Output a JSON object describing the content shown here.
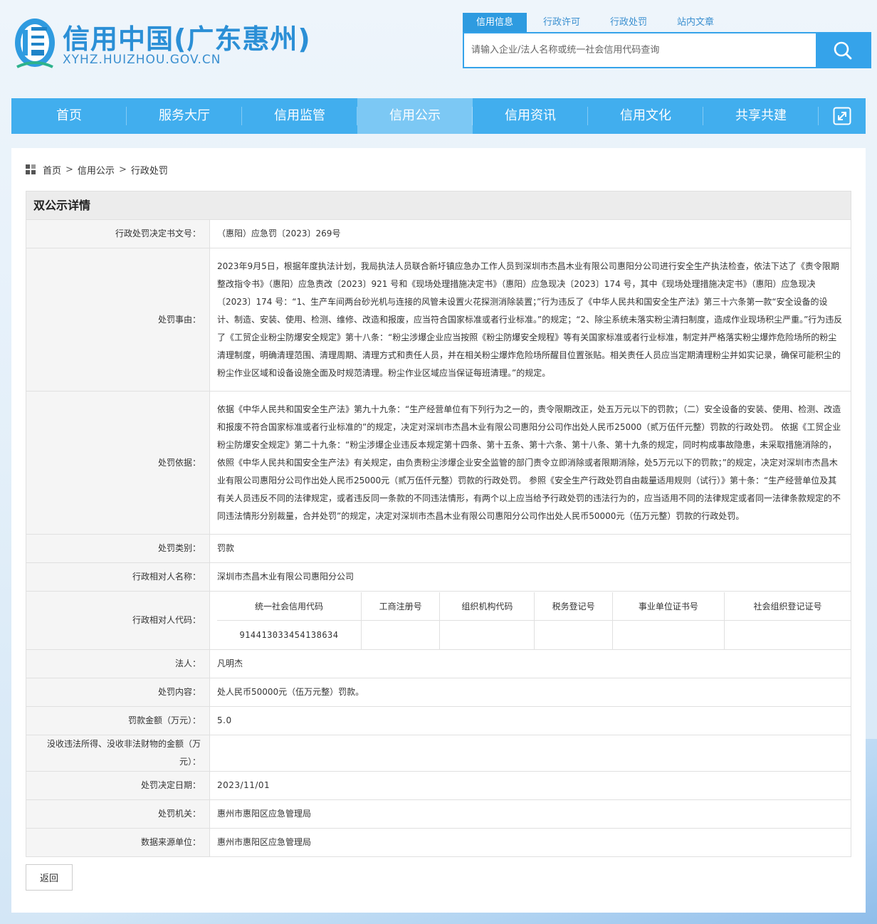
{
  "site": {
    "title": "信用中国(广东惠州)",
    "url": "XYHZ.HUIZHOU.GOV.CN"
  },
  "search": {
    "tabs": [
      {
        "label": "信用信息",
        "active": true
      },
      {
        "label": "行政许可",
        "active": false
      },
      {
        "label": "行政处罚",
        "active": false
      },
      {
        "label": "站内文章",
        "active": false
      }
    ],
    "placeholder": "请输入企业/法人名称或统一社会信用代码查询"
  },
  "nav": {
    "items": [
      {
        "label": "首页",
        "active": false
      },
      {
        "label": "服务大厅",
        "active": false
      },
      {
        "label": "信用监管",
        "active": false
      },
      {
        "label": "信用公示",
        "active": true
      },
      {
        "label": "信用资讯",
        "active": false
      },
      {
        "label": "信用文化",
        "active": false
      },
      {
        "label": "共享共建",
        "active": false
      }
    ]
  },
  "breadcrumb": {
    "home": "首页",
    "sep": ">",
    "level1": "信用公示",
    "level2": "行政处罚"
  },
  "detail": {
    "title": "双公示详情",
    "rows": {
      "doc_no": {
        "label": "行政处罚决定书文号：",
        "value": "（惠阳）应急罚〔2023〕269号"
      },
      "reason": {
        "label": "处罚事由：",
        "value": "2023年9月5日，根据年度执法计划，我局执法人员联合新圩镇应急办工作人员到深圳市杰昌木业有限公司惠阳分公司进行安全生产执法检查，依法下达了《责令限期整改指令书》（惠阳）应急责改〔2023〕921 号和《现场处理措施决定书》（惠阳）应急现决〔2023〕174 号，其中《现场处理措施决定书》（惠阳）应急现决〔2023〕174 号：“1、生产车间两台砂光机与连接的风管未设置火花探测消除装置；”行为违反了《中华人民共和国安全生产法》第三十六条第一款“安全设备的设计、制造、安装、使用、检测、维修、改造和报废，应当符合国家标准或者行业标准。”的规定；“2、除尘系统未落实粉尘清扫制度，造成作业现场积尘严重。”行为违反了《工贸企业粉尘防爆安全规定》第十八条：“粉尘涉爆企业应当按照《粉尘防爆安全规程》等有关国家标准或者行业标准，制定并严格落实粉尘爆炸危险场所的粉尘清理制度，明确清理范围、清理周期、清理方式和责任人员，并在相关粉尘爆炸危险场所醒目位置张贴。相关责任人员应当定期清理粉尘并如实记录，确保可能积尘的粉尘作业区域和设备设施全面及时规范清理。粉尘作业区域应当保证每班清理。”的规定。"
      },
      "basis": {
        "label": "处罚依据：",
        "value": "依据《中华人民共和国安全生产法》第九十九条：“生产经营单位有下列行为之一的，责令限期改正，处五万元以下的罚款；（二）安全设备的安装、使用、检测、改造和报废不符合国家标准或者行业标准的”的规定，决定对深圳市杰昌木业有限公司惠阳分公司作出处人民币25000（贰万伍仟元整）罚款的行政处罚。 依据《工贸企业粉尘防爆安全规定》第二十九条：“粉尘涉爆企业违反本规定第十四条、第十五条、第十六条、第十八条、第十九条的规定，同时构成事故隐患，未采取措施消除的，依照《中华人民共和国安全生产法》有关规定，由负责粉尘涉爆企业安全监管的部门责令立即消除或者限期消除，处5万元以下的罚款；”的规定，决定对深圳市杰昌木业有限公司惠阳分公司作出处人民币25000元（贰万伍仟元整）罚款的行政处罚。 参照《安全生产行政处罚自由裁量适用规则（试行）》第十条：“生产经营单位及其有关人员违反不同的法律规定，或者违反同一条款的不同违法情形，有两个以上应当给予行政处罚的违法行为的，应当适用不同的法律规定或者同一法律条款规定的不同违法情形分别裁量，合并处罚”的规定，决定对深圳市杰昌木业有限公司惠阳分公司作出处人民币50000元（伍万元整）罚款的行政处罚。"
      },
      "category": {
        "label": "处罚类别：",
        "value": "罚款"
      },
      "party_name": {
        "label": "行政相对人名称：",
        "value": "深圳市杰昌木业有限公司惠阳分公司"
      },
      "party_code": {
        "label": "行政相对人代码：",
        "headers": [
          "统一社会信用代码",
          "工商注册号",
          "组织机构代码",
          "税务登记号",
          "事业单位证书号",
          "社会组织登记证号"
        ],
        "values": [
          "914413033454138634",
          "",
          "",
          "",
          "",
          ""
        ]
      },
      "legal_person": {
        "label": "法人：",
        "value": "凡明杰"
      },
      "content": {
        "label": "处罚内容：",
        "value": "处人民币50000元（伍万元整）罚款。"
      },
      "amount": {
        "label": "罚款金额（万元）：",
        "value": "5.0"
      },
      "confiscation": {
        "label": "没收违法所得、没收非法财物的金额（万元）：",
        "value": ""
      },
      "decision_date": {
        "label": "处罚决定日期：",
        "value": "2023/11/01"
      },
      "authority": {
        "label": "处罚机关：",
        "value": "惠州市惠阳区应急管理局"
      },
      "source": {
        "label": "数据来源单位：",
        "value": "惠州市惠阳区应急管理局"
      }
    }
  },
  "actions": {
    "back": "返回"
  },
  "colors": {
    "brand": "#2b8fd6",
    "nav_bg": "#41aeee",
    "nav_active": "#7cc8f4",
    "search_accent": "#35a3ea"
  },
  "icons": [
    "logo-icon",
    "search-icon",
    "expand-icon",
    "breadcrumb-grid-icon"
  ]
}
